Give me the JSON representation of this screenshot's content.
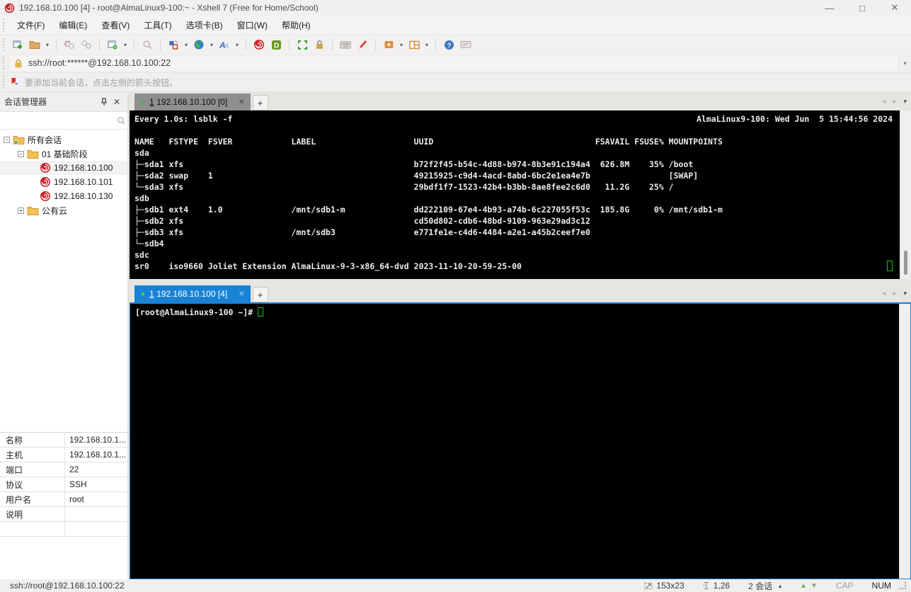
{
  "window": {
    "title": "192.168.10.100 [4] - root@AlmaLinux9-100:~ - Xshell 7 (Free for Home/School)",
    "controls": {
      "minimize": "—",
      "maximize": "□",
      "close": "✕"
    }
  },
  "menu": {
    "items": [
      "文件(F)",
      "编辑(E)",
      "查看(V)",
      "工具(T)",
      "选项卡(B)",
      "窗口(W)",
      "帮助(H)"
    ]
  },
  "toolbar": {
    "icons": [
      "new-session",
      "open-session",
      "disconnect",
      "reconnect",
      "session-properties",
      "find",
      "color-scheme",
      "web-browser",
      "font",
      "xshell-app",
      "xftp-app",
      "fullscreen",
      "lock-screen",
      "virtual-keyboard",
      "highlighter",
      "new-file",
      "tile-layout",
      "help",
      "feedback"
    ]
  },
  "address_bar": {
    "url": "ssh://root:******@192.168.10.100:22"
  },
  "info_bar": {
    "message": "要添加当前会话，点击左侧的箭头按钮。"
  },
  "session_manager": {
    "title": "会话管理器",
    "tree": [
      {
        "label": "所有会话"
      },
      {
        "label": "01 基础阶段"
      },
      {
        "label": "192.168.10.100"
      },
      {
        "label": "192.168.10.101"
      },
      {
        "label": "192.168.10.130"
      },
      {
        "label": "公有云"
      }
    ],
    "properties": {
      "rows": [
        {
          "key": "名称",
          "value": "192.168.10.1..."
        },
        {
          "key": "主机",
          "value": "192.168.10.1..."
        },
        {
          "key": "端口",
          "value": "22"
        },
        {
          "key": "协议",
          "value": "SSH"
        },
        {
          "key": "用户名",
          "value": "root"
        },
        {
          "key": "说明",
          "value": ""
        }
      ]
    }
  },
  "tabs": {
    "pane1": {
      "number": "1",
      "label": "192.168.10.100 [0]",
      "close": "✕",
      "new": "+"
    },
    "pane2": {
      "number": "1",
      "label": "192.168.10.100 [4]",
      "close": "✕",
      "new": "+"
    }
  },
  "terminal1": {
    "watch_left": "Every 1.0s: lsblk -f",
    "watch_right": "AlmaLinux9-100: Wed Jun  5 15:44:56 2024",
    "lines": [
      "",
      "NAME   FSTYPE  FSVER            LABEL                    UUID                                 FSAVAIL FSUSE% MOUNTPOINTS",
      "sda",
      "├─sda1 xfs                                               b72f2f45-b54c-4d88-b974-8b3e91c194a4  626.8M    35% /boot",
      "├─sda2 swap    1                                         49215925-c9d4-4acd-8abd-6bc2e1ea4e7b                [SWAP]",
      "└─sda3 xfs                                               29bdf1f7-1523-42b4-b3bb-8ae8fee2c6d0   11.2G    25% /",
      "sdb",
      "├─sdb1 ext4    1.0              /mnt/sdb1-m              dd222109-67e4-4b93-a74b-6c227055f53c  185.8G     0% /mnt/sdb1-m",
      "├─sdb2 xfs                                               cd50d802-cdb6-48bd-9109-963e29ad3c12",
      "├─sdb3 xfs                      /mnt/sdb3                e771fe1e-c4d6-4484-a2e1-a45b2ceef7e0",
      "└─sdb4",
      "sdc",
      "sr0    iso9660 Joliet Extension AlmaLinux-9-3-x86_64-dvd 2023-11-10-20-59-25-00"
    ]
  },
  "terminal2": {
    "prompt": "[root@AlmaLinux9-100 ~]# "
  },
  "status_bar": {
    "left": "ssh://root@192.168.10.100:22",
    "size": "153x23",
    "cursor_pos": "1,26",
    "sessions": "2 会话",
    "cap": "CAP",
    "num": "NUM"
  },
  "colors": {
    "tab_active": "#1982d4",
    "tab_inactive": "#8f8f8f",
    "terminal_green": "#16c60c",
    "xshell_red": "#cc2229",
    "chrome_bg": "#f0efed"
  }
}
